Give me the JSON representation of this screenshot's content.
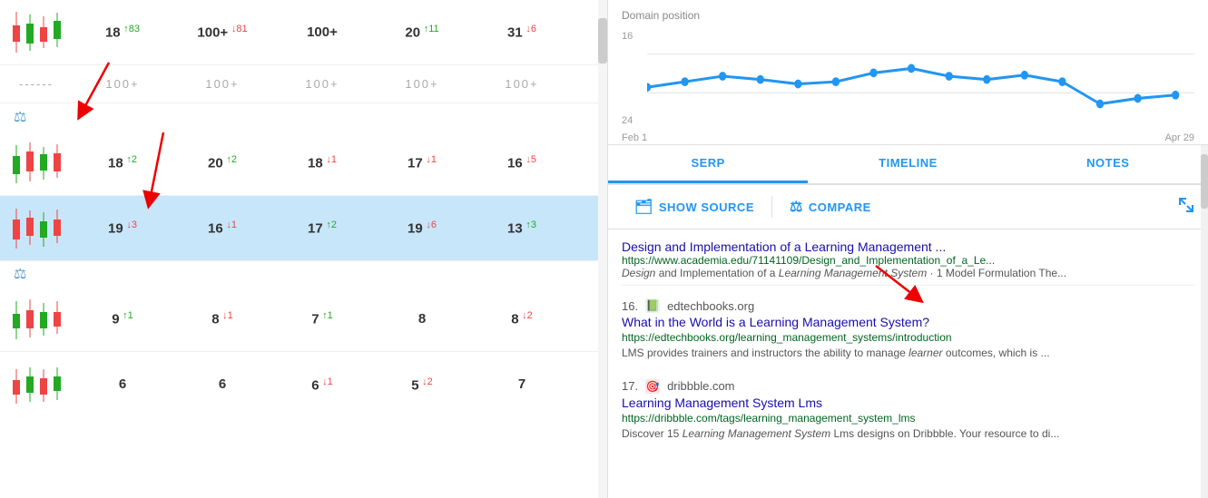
{
  "left": {
    "rows": [
      {
        "type": "data",
        "cols": [
          "18",
          "100+",
          "100+",
          "20",
          "31"
        ],
        "changes": [
          "+83",
          "+81",
          "",
          "+11",
          "-6"
        ],
        "change_dirs": [
          "up",
          "down",
          "",
          "up",
          "down"
        ]
      },
      {
        "type": "dotted",
        "cols": [
          "100+",
          "100+",
          "100+",
          "100+",
          "100+"
        ]
      },
      {
        "type": "icon",
        "icon": "⚖"
      },
      {
        "type": "data",
        "rank": "18",
        "rank_change": "2",
        "rank_dir": "up",
        "cols": [
          "20",
          "18",
          "17",
          "16"
        ],
        "changes": [
          "+2",
          "-1",
          "-1",
          "-5"
        ],
        "change_dirs": [
          "up",
          "down",
          "down",
          "down"
        ]
      },
      {
        "type": "data_highlight",
        "rank": "19",
        "rank_change": "3",
        "rank_dir": "down",
        "cols": [
          "16",
          "17",
          "19",
          "13"
        ],
        "changes": [
          "-1",
          "+2",
          "-6",
          "+3"
        ],
        "change_dirs": [
          "down",
          "up",
          "down",
          "up"
        ]
      },
      {
        "type": "icon",
        "icon": "⚖"
      },
      {
        "type": "data",
        "rank": "9",
        "rank_change": "1",
        "rank_dir": "up",
        "cols": [
          "8",
          "7",
          "8",
          "8"
        ],
        "changes": [
          "-1",
          "+1",
          "",
          "-2"
        ],
        "change_dirs": [
          "down",
          "up",
          "",
          "down"
        ]
      },
      {
        "type": "data",
        "rank": "6",
        "rank_change": "",
        "rank_dir": "",
        "cols": [
          "6",
          "6",
          "5",
          "7"
        ],
        "changes": [
          "",
          "",
          "-1",
          ""
        ],
        "change_dirs": [
          "",
          "",
          "down",
          ""
        ]
      }
    ]
  },
  "right": {
    "chart": {
      "title": "Domain position",
      "y_labels": [
        "16",
        "24"
      ],
      "x_labels": [
        "Feb 1",
        "Apr 29"
      ]
    },
    "tabs": [
      {
        "label": "SERP",
        "active": true
      },
      {
        "label": "TIMELINE",
        "active": false
      },
      {
        "label": "NOTES",
        "active": false
      }
    ],
    "actions": {
      "show_source": "SHOW SOURCE",
      "compare": "COMPARE"
    },
    "serp_results": [
      {
        "num": "",
        "favicon": "📄",
        "domain": "",
        "title": "Design and Implementation of a Learning Management ...",
        "url": "https://www.academia.edu/71141109/Design_and_Implementation_of_a_Le...",
        "snippet": "Design and Implementation of a Learning Management System · 1 Model Formulation The..."
      },
      {
        "num": "16.",
        "favicon": "📗",
        "domain": "edtechbooks.org",
        "title": "What in the World is a Learning Management System?",
        "url": "https://edtechbooks.org/learning_management_systems/introduction",
        "snippet": "LMS provides trainers and instructors the ability to manage learner outcomes, which is ..."
      },
      {
        "num": "17.",
        "favicon": "🎯",
        "domain": "dribbble.com",
        "title": "Learning Management System Lms",
        "url": "https://dribbble.com/tags/learning_management_system_lms",
        "snippet": "Discover 15 Learning Management System Lms designs on Dribbble. Your resource to di..."
      }
    ]
  }
}
